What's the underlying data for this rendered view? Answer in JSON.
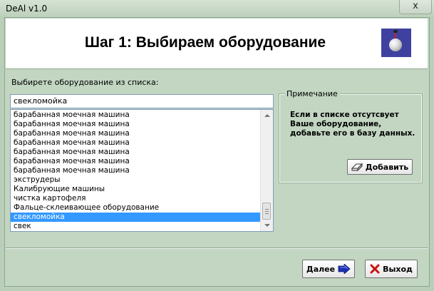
{
  "window": {
    "title": "DeAl v1.0",
    "close_glyph": "x"
  },
  "header": {
    "heading": "Шаг 1: Выбираем оборудование",
    "logo_icon": "globe-icon"
  },
  "equipment": {
    "label": "Выбирете оборудование из списка:",
    "input_value": "свекломойка",
    "items": [
      "барабанная моечная машина",
      "барабанная моечная машина",
      "барабанная моечная машина",
      "барабанная моечная машина",
      "барабанная моечная машина",
      "барабанная моечная машина",
      "барабанная моечная машина",
      "экструдеры",
      "Калибрующие машины",
      "чистка картофеля",
      "Фальце-склеивающее оборудование",
      "свекломойка",
      "свек"
    ],
    "selected_index": 11
  },
  "note": {
    "legend": "Примечание",
    "text": "Если в списке отсутсвует Ваше оборудование, добавьте его в базу данных.",
    "add_label": "Добавить"
  },
  "footer": {
    "next_label": "Далее",
    "exit_label": "Выход"
  },
  "colors": {
    "window_bg": "#c2d6c2",
    "selection": "#3399ff",
    "next_arrow": "#1a2fb5",
    "exit_x": "#cc1111"
  }
}
